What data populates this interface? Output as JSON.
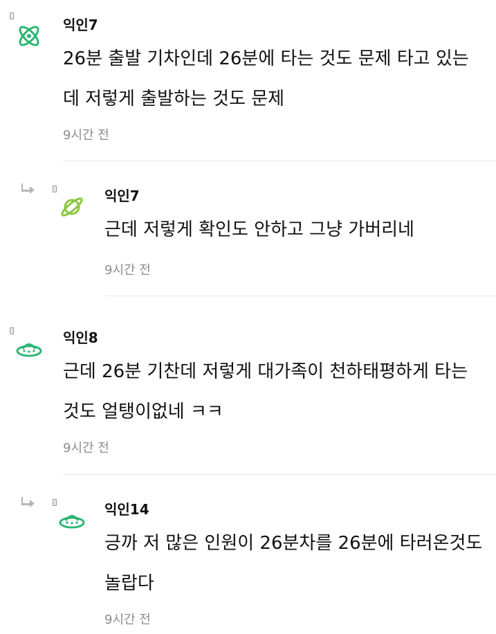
{
  "comments": [
    {
      "nickname": "익인7",
      "text": "26분 출발 기차인데 26분에 타는 것도 문제 타고 있는데 저렇게 출발하는 것도 문제",
      "time": "9시간 전",
      "avatar_icon": "atom-icon",
      "color": "#2bb673",
      "is_reply": false
    },
    {
      "nickname": "익인7",
      "text": "근데 저렇게 확인도 안하고 그냥 가버리네",
      "time": "9시간 전",
      "avatar_icon": "planet-icon",
      "color": "#8cc63f",
      "is_reply": true
    },
    {
      "nickname": "익인8",
      "text": "근데 26분 기찬데 저렇게 대가족이 천하태평하게 타는 것도 얼탱이없네 ㅋㅋ",
      "time": "9시간 전",
      "avatar_icon": "ufo-icon",
      "color": "#2bb673",
      "is_reply": false
    },
    {
      "nickname": "익인14",
      "text": "긍까 저 많은 인원이 26분차를 26분에 타러온것도 놀랍다",
      "time": "9시간 전",
      "avatar_icon": "ufo-icon",
      "color": "#2bb673",
      "is_reply": true
    }
  ],
  "icons": {
    "reply_arrow": "reply-arrow-icon"
  }
}
